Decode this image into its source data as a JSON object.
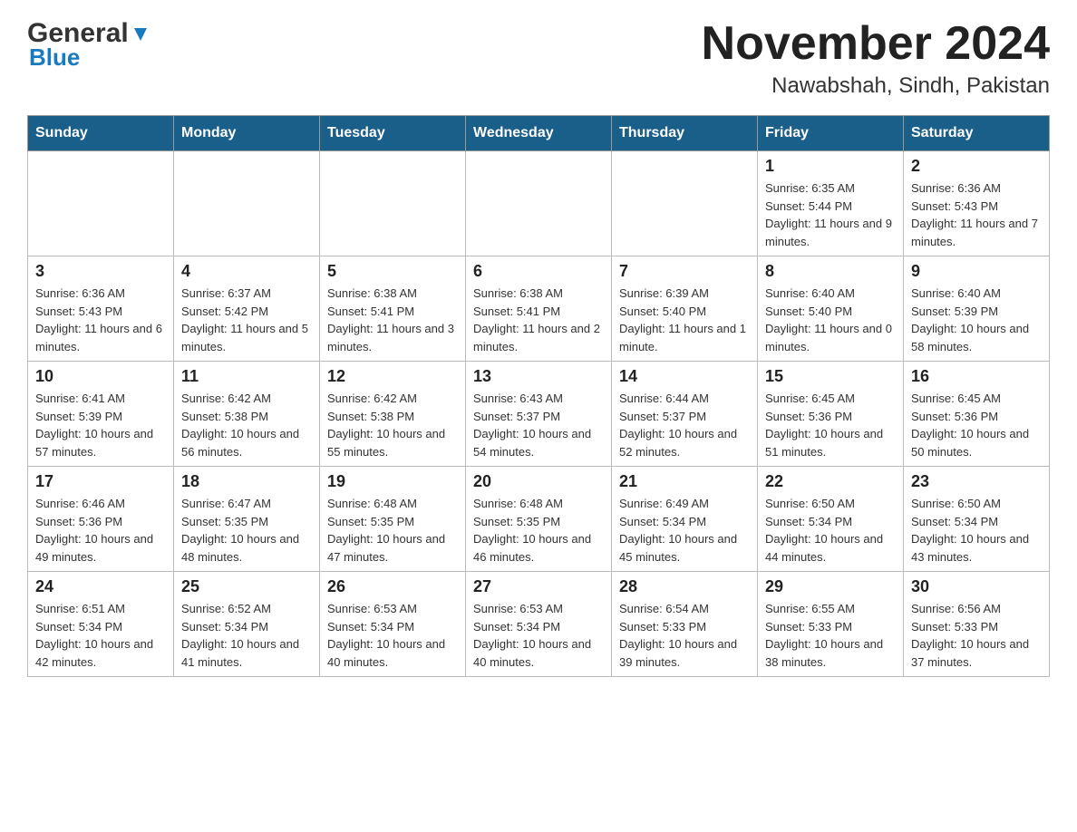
{
  "header": {
    "logo_general": "General",
    "logo_blue": "Blue",
    "month_title": "November 2024",
    "location": "Nawabshah, Sindh, Pakistan"
  },
  "weekdays": [
    "Sunday",
    "Monday",
    "Tuesday",
    "Wednesday",
    "Thursday",
    "Friday",
    "Saturday"
  ],
  "weeks": [
    [
      {
        "day": "",
        "info": ""
      },
      {
        "day": "",
        "info": ""
      },
      {
        "day": "",
        "info": ""
      },
      {
        "day": "",
        "info": ""
      },
      {
        "day": "",
        "info": ""
      },
      {
        "day": "1",
        "info": "Sunrise: 6:35 AM\nSunset: 5:44 PM\nDaylight: 11 hours and 9 minutes."
      },
      {
        "day": "2",
        "info": "Sunrise: 6:36 AM\nSunset: 5:43 PM\nDaylight: 11 hours and 7 minutes."
      }
    ],
    [
      {
        "day": "3",
        "info": "Sunrise: 6:36 AM\nSunset: 5:43 PM\nDaylight: 11 hours and 6 minutes."
      },
      {
        "day": "4",
        "info": "Sunrise: 6:37 AM\nSunset: 5:42 PM\nDaylight: 11 hours and 5 minutes."
      },
      {
        "day": "5",
        "info": "Sunrise: 6:38 AM\nSunset: 5:41 PM\nDaylight: 11 hours and 3 minutes."
      },
      {
        "day": "6",
        "info": "Sunrise: 6:38 AM\nSunset: 5:41 PM\nDaylight: 11 hours and 2 minutes."
      },
      {
        "day": "7",
        "info": "Sunrise: 6:39 AM\nSunset: 5:40 PM\nDaylight: 11 hours and 1 minute."
      },
      {
        "day": "8",
        "info": "Sunrise: 6:40 AM\nSunset: 5:40 PM\nDaylight: 11 hours and 0 minutes."
      },
      {
        "day": "9",
        "info": "Sunrise: 6:40 AM\nSunset: 5:39 PM\nDaylight: 10 hours and 58 minutes."
      }
    ],
    [
      {
        "day": "10",
        "info": "Sunrise: 6:41 AM\nSunset: 5:39 PM\nDaylight: 10 hours and 57 minutes."
      },
      {
        "day": "11",
        "info": "Sunrise: 6:42 AM\nSunset: 5:38 PM\nDaylight: 10 hours and 56 minutes."
      },
      {
        "day": "12",
        "info": "Sunrise: 6:42 AM\nSunset: 5:38 PM\nDaylight: 10 hours and 55 minutes."
      },
      {
        "day": "13",
        "info": "Sunrise: 6:43 AM\nSunset: 5:37 PM\nDaylight: 10 hours and 54 minutes."
      },
      {
        "day": "14",
        "info": "Sunrise: 6:44 AM\nSunset: 5:37 PM\nDaylight: 10 hours and 52 minutes."
      },
      {
        "day": "15",
        "info": "Sunrise: 6:45 AM\nSunset: 5:36 PM\nDaylight: 10 hours and 51 minutes."
      },
      {
        "day": "16",
        "info": "Sunrise: 6:45 AM\nSunset: 5:36 PM\nDaylight: 10 hours and 50 minutes."
      }
    ],
    [
      {
        "day": "17",
        "info": "Sunrise: 6:46 AM\nSunset: 5:36 PM\nDaylight: 10 hours and 49 minutes."
      },
      {
        "day": "18",
        "info": "Sunrise: 6:47 AM\nSunset: 5:35 PM\nDaylight: 10 hours and 48 minutes."
      },
      {
        "day": "19",
        "info": "Sunrise: 6:48 AM\nSunset: 5:35 PM\nDaylight: 10 hours and 47 minutes."
      },
      {
        "day": "20",
        "info": "Sunrise: 6:48 AM\nSunset: 5:35 PM\nDaylight: 10 hours and 46 minutes."
      },
      {
        "day": "21",
        "info": "Sunrise: 6:49 AM\nSunset: 5:34 PM\nDaylight: 10 hours and 45 minutes."
      },
      {
        "day": "22",
        "info": "Sunrise: 6:50 AM\nSunset: 5:34 PM\nDaylight: 10 hours and 44 minutes."
      },
      {
        "day": "23",
        "info": "Sunrise: 6:50 AM\nSunset: 5:34 PM\nDaylight: 10 hours and 43 minutes."
      }
    ],
    [
      {
        "day": "24",
        "info": "Sunrise: 6:51 AM\nSunset: 5:34 PM\nDaylight: 10 hours and 42 minutes."
      },
      {
        "day": "25",
        "info": "Sunrise: 6:52 AM\nSunset: 5:34 PM\nDaylight: 10 hours and 41 minutes."
      },
      {
        "day": "26",
        "info": "Sunrise: 6:53 AM\nSunset: 5:34 PM\nDaylight: 10 hours and 40 minutes."
      },
      {
        "day": "27",
        "info": "Sunrise: 6:53 AM\nSunset: 5:34 PM\nDaylight: 10 hours and 40 minutes."
      },
      {
        "day": "28",
        "info": "Sunrise: 6:54 AM\nSunset: 5:33 PM\nDaylight: 10 hours and 39 minutes."
      },
      {
        "day": "29",
        "info": "Sunrise: 6:55 AM\nSunset: 5:33 PM\nDaylight: 10 hours and 38 minutes."
      },
      {
        "day": "30",
        "info": "Sunrise: 6:56 AM\nSunset: 5:33 PM\nDaylight: 10 hours and 37 minutes."
      }
    ]
  ]
}
